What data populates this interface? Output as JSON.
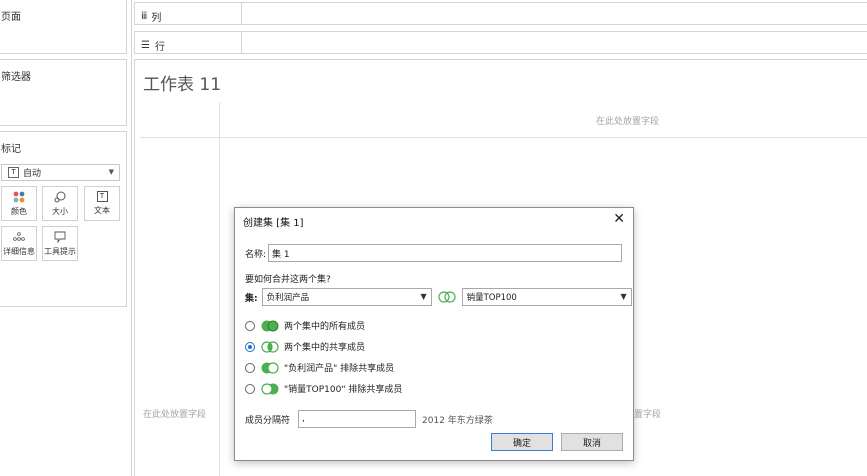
{
  "left": {
    "pages_title": "页面",
    "filters_title": "筛选器",
    "marks_title": "标记",
    "marks_type": "自动",
    "marks_buttons": [
      {
        "label": "颜色",
        "icon": "color-dots-icon"
      },
      {
        "label": "大小",
        "icon": "size-icon"
      },
      {
        "label": "文本",
        "icon": "text-icon"
      },
      {
        "label": "详细信息",
        "icon": "detail-icon"
      },
      {
        "label": "工具提示",
        "icon": "tooltip-icon"
      }
    ]
  },
  "shelves": {
    "columns_label": "列",
    "rows_label": "行"
  },
  "worksheet": {
    "title": "工作表 11",
    "drop_field_top": "在此处放置字段",
    "drop_field_left": "在此处放置字段",
    "drop_field_right": "置字段"
  },
  "dialog": {
    "title": "创建集 [集 1]",
    "name_label": "名称:",
    "name_value": "集 1",
    "question": "要如何合并这两个集?",
    "sets_label": "集:",
    "set_left": "负利润产品",
    "set_right": "销量TOP100",
    "options": [
      {
        "label": "两个集中的所有成员",
        "selected": false
      },
      {
        "label": "两个集中的共享成员",
        "selected": true
      },
      {
        "label": "\"负利润产品\" 排除共享成员",
        "selected": false
      },
      {
        "label": "\"销量TOP100\" 排除共享成员",
        "selected": false
      }
    ],
    "separator_label": "成员分隔符",
    "separator_value": ",",
    "separator_note": "2012 年东方绿茶",
    "ok_label": "确定",
    "cancel_label": "取消",
    "accent_color": "#1e6fd0",
    "venn_color": "#4caf50"
  }
}
